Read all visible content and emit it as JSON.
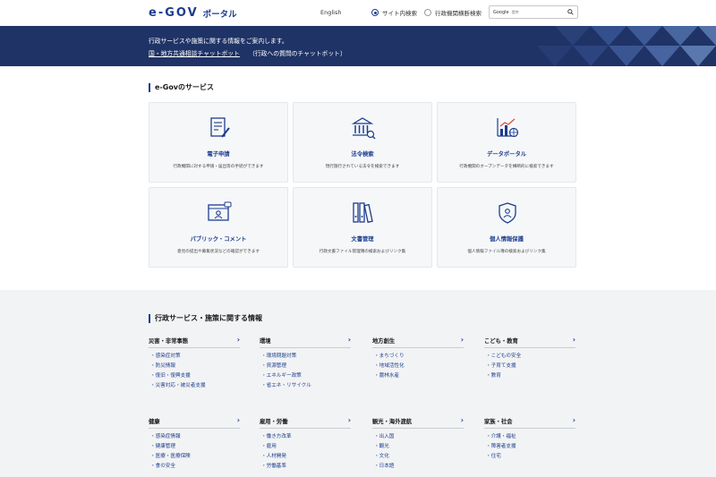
{
  "header": {
    "logo_text": "e-GOV",
    "logo_sub": "ポータル",
    "language": "English",
    "radio_site": "サイト内検索",
    "radio_cross": "行政機関横断検索",
    "search_google": "Google",
    "search_placeholder": "提供"
  },
  "banner": {
    "line1": "行政サービスや施策に関する情報をご案内します。",
    "chatbot_link": "国・地方共通相談チャットボット",
    "chatbot_note": "（行政への質問のチャットボット）"
  },
  "services": {
    "title": "e-Govのサービス",
    "cards": [
      {
        "title": "電子申請",
        "desc": "行政機関に対する申請・届出等の手続ができます",
        "icon": "document-pen-icon"
      },
      {
        "title": "法令検索",
        "desc": "現行施行されている法令を検索できます",
        "icon": "building-search-icon"
      },
      {
        "title": "データポータル",
        "desc": "行政機関のオープンデータを横断的に検索できます",
        "icon": "chart-globe-icon"
      },
      {
        "title": "パブリック・コメント",
        "desc": "意見の提出や募集状況などの確認ができます",
        "icon": "window-person-icon"
      },
      {
        "title": "文書管理",
        "desc": "行政文書ファイル管理簿の検索およびリンク集",
        "icon": "binders-icon"
      },
      {
        "title": "個人情報保護",
        "desc": "個人情報ファイル簿の検索およびリンク集",
        "icon": "shield-person-icon"
      }
    ]
  },
  "info": {
    "title": "行政サービス・施策に関する情報",
    "categories": [
      {
        "title": "災害・非常事態",
        "items": [
          "感染症対策",
          "防災情報",
          "復旧・復興支援",
          "災害対応・被災者支援"
        ]
      },
      {
        "title": "環境",
        "items": [
          "環境問題対策",
          "資源管理",
          "エネルギー政策",
          "省エネ・リサイクル"
        ]
      },
      {
        "title": "地方創生",
        "items": [
          "まちづくり",
          "地域活性化",
          "農林水産"
        ]
      },
      {
        "title": "こども・教育",
        "items": [
          "こどもの安全",
          "子育て支援",
          "教育"
        ]
      },
      {
        "title": "健康",
        "items": [
          "感染症情報",
          "健康管理",
          "医療・医療保険",
          "食の安全"
        ]
      },
      {
        "title": "雇用・労働",
        "items": [
          "働き方改革",
          "雇用",
          "人材開発",
          "労働基準"
        ]
      },
      {
        "title": "観光・海外渡航",
        "items": [
          "出入国",
          "観光",
          "文化",
          "日本語"
        ]
      },
      {
        "title": "家族・社会",
        "items": [
          "介護・福祉",
          "障害者支援",
          "住宅"
        ]
      }
    ]
  },
  "colors": {
    "accent": "#1b3d8f",
    "banner": "#1f3366"
  }
}
